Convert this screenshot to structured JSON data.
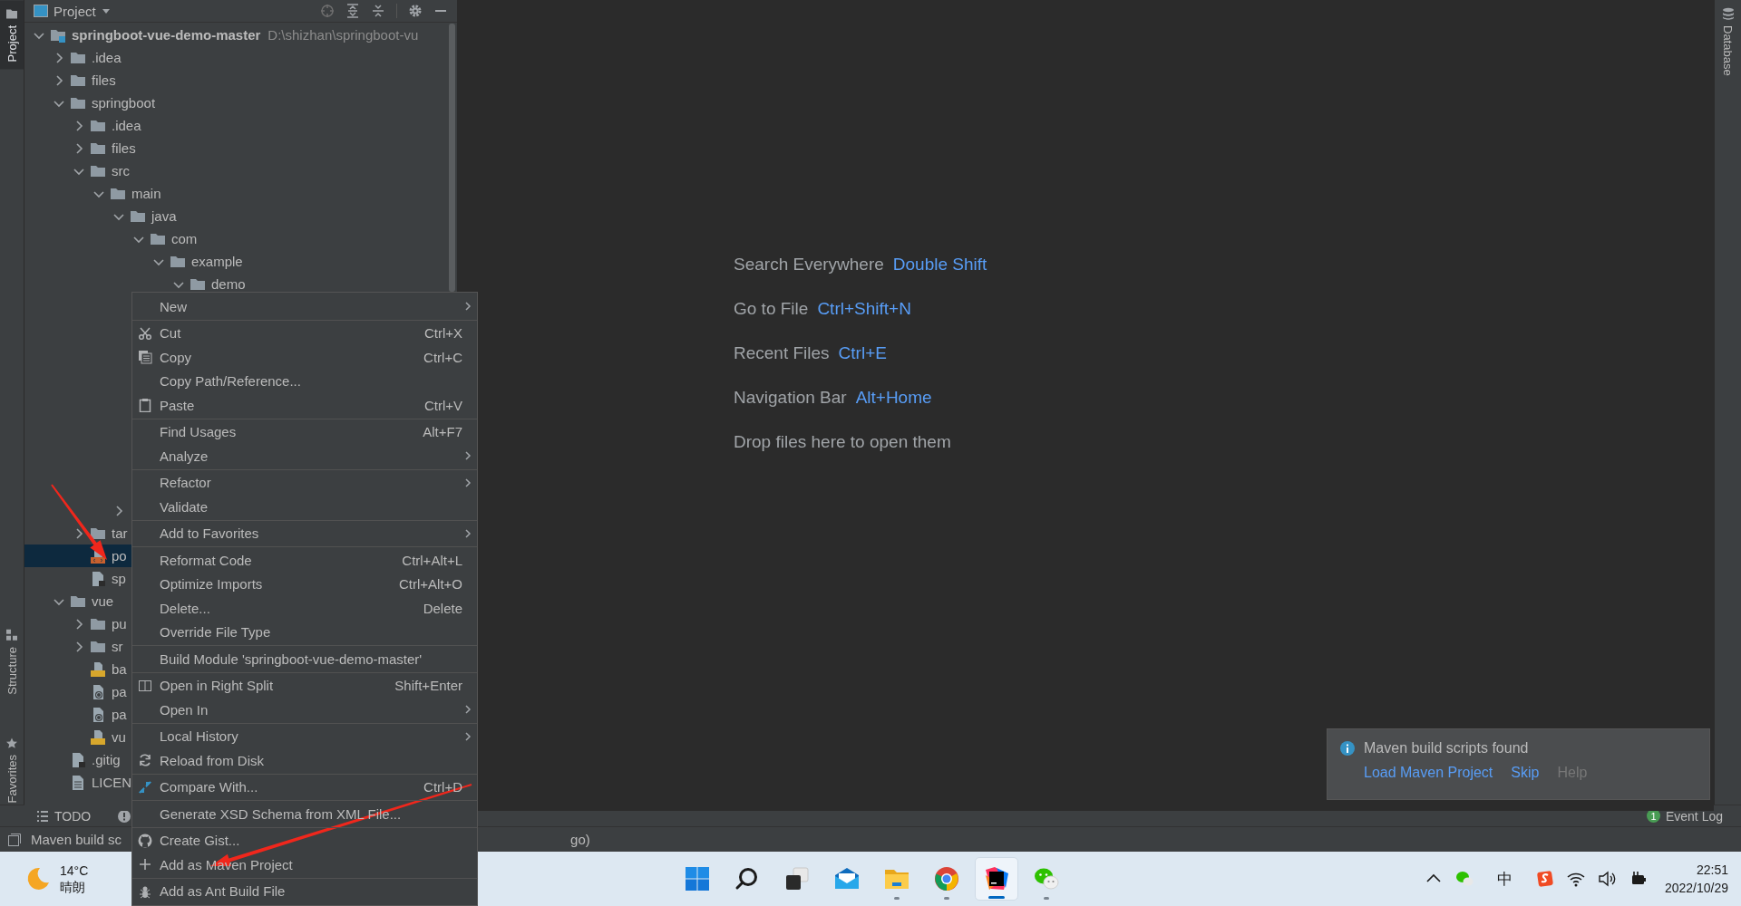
{
  "left_strip": {
    "tabs": [
      {
        "label": "Project",
        "selected": true
      },
      {
        "label": "Structure",
        "selected": false
      },
      {
        "label": "Favorites",
        "selected": false
      }
    ]
  },
  "project_panel": {
    "title": "Project",
    "tree": [
      {
        "label": "springboot-vue-demo-master",
        "path": "D:\\shizhan\\springboot-vu",
        "kind": "module",
        "expanded": true,
        "selected": false,
        "children": [
          {
            "label": ".idea",
            "kind": "folder",
            "expanded": false,
            "selected": false
          },
          {
            "label": "files",
            "kind": "folder",
            "expanded": false,
            "selected": false
          },
          {
            "label": "springboot",
            "kind": "folder",
            "expanded": true,
            "selected": false,
            "children": [
              {
                "label": ".idea",
                "kind": "folder",
                "expanded": false,
                "selected": false
              },
              {
                "label": "files",
                "kind": "folder",
                "expanded": false,
                "selected": false
              },
              {
                "label": "src",
                "kind": "folder",
                "expanded": true,
                "selected": false,
                "children": [
                  {
                    "label": "main",
                    "kind": "folder",
                    "expanded": true,
                    "selected": false,
                    "children": [
                      {
                        "label": "java",
                        "kind": "folder",
                        "expanded": true,
                        "selected": false,
                        "children": [
                          {
                            "label": "com",
                            "kind": "folder",
                            "expanded": true,
                            "selected": false,
                            "children": [
                              {
                                "label": "example",
                                "kind": "folder",
                                "expanded": true,
                                "selected": false,
                                "children": [
                                  {
                                    "label": "demo",
                                    "kind": "folder",
                                    "expanded": true,
                                    "selected": false
                                  }
                                ]
                              }
                            ]
                          }
                        ]
                      },
                      {
                        "kind": "folder",
                        "expanded": false,
                        "selected": false
                      }
                    ]
                  }
                ]
              },
              {
                "label": "tar",
                "kind": "folder",
                "expanded": false,
                "selected": false
              },
              {
                "label": "po",
                "kind": "xml",
                "selected": true
              },
              {
                "label": "sp",
                "kind": "file",
                "selected": false
              }
            ]
          },
          {
            "label": "vue",
            "kind": "folder",
            "expanded": true,
            "selected": false,
            "children": [
              {
                "label": "pu",
                "kind": "folder",
                "expanded": false,
                "selected": false
              },
              {
                "label": "sr",
                "kind": "folder",
                "expanded": false,
                "selected": false
              },
              {
                "label": "ba",
                "kind": "js",
                "selected": false
              },
              {
                "label": "pa",
                "kind": "json",
                "selected": false
              },
              {
                "label": "pa",
                "kind": "json",
                "selected": false
              },
              {
                "label": "vu",
                "kind": "js",
                "selected": false
              }
            ]
          },
          {
            "label": ".gitig",
            "kind": "file",
            "selected": false
          },
          {
            "label": "LICEN",
            "kind": "text",
            "selected": false
          }
        ]
      }
    ]
  },
  "editor": {
    "hints": [
      {
        "label": "Search Everywhere",
        "shortcut": "Double Shift"
      },
      {
        "label": "Go to File",
        "shortcut": "Ctrl+Shift+N"
      },
      {
        "label": "Recent Files",
        "shortcut": "Ctrl+E"
      },
      {
        "label": "Navigation Bar",
        "shortcut": "Alt+Home"
      },
      {
        "label": "Drop files here to open them"
      }
    ],
    "notification": {
      "message": "Maven build scripts found",
      "links": [
        {
          "label": "Load Maven Project",
          "disabled": false
        },
        {
          "label": "Skip",
          "disabled": false
        },
        {
          "label": "Help",
          "disabled": true
        }
      ]
    }
  },
  "right_strip": {
    "tabs": [
      {
        "label": "Database",
        "selected": false
      }
    ]
  },
  "context_menu": {
    "groups": [
      [
        {
          "label": "New",
          "submenu": true
        }
      ],
      [
        {
          "label": "Cut",
          "shortcut": "Ctrl+X",
          "submenu": false
        },
        {
          "label": "Copy",
          "shortcut": "Ctrl+C",
          "submenu": false
        },
        {
          "label": "Copy Path/Reference...",
          "submenu": false
        },
        {
          "label": "Paste",
          "shortcut": "Ctrl+V",
          "submenu": false
        }
      ],
      [
        {
          "label": "Find Usages",
          "shortcut": "Alt+F7",
          "submenu": false
        },
        {
          "label": "Analyze",
          "submenu": true
        }
      ],
      [
        {
          "label": "Refactor",
          "submenu": true
        },
        {
          "label": "Validate",
          "submenu": false
        }
      ],
      [
        {
          "label": "Add to Favorites",
          "submenu": true
        }
      ],
      [
        {
          "label": "Reformat Code",
          "shortcut": "Ctrl+Alt+L",
          "submenu": false
        },
        {
          "label": "Optimize Imports",
          "shortcut": "Ctrl+Alt+O",
          "submenu": false
        },
        {
          "label": "Delete...",
          "shortcut": "Delete",
          "submenu": false
        },
        {
          "label": "Override File Type",
          "submenu": false
        }
      ],
      [
        {
          "label": "Build Module 'springboot-vue-demo-master'",
          "submenu": false
        }
      ],
      [
        {
          "label": "Open in Right Split",
          "shortcut": "Shift+Enter",
          "submenu": false
        },
        {
          "label": "Open In",
          "submenu": true
        }
      ],
      [
        {
          "label": "Local History",
          "submenu": true
        },
        {
          "label": "Reload from Disk",
          "submenu": false
        }
      ],
      [
        {
          "label": "Compare With...",
          "shortcut": "Ctrl+D",
          "submenu": false
        }
      ],
      [
        {
          "label": "Generate XSD Schema from XML File...",
          "submenu": false
        }
      ],
      [
        {
          "label": "Create Gist...",
          "submenu": false
        },
        {
          "label": "Add as Maven Project",
          "submenu": false
        }
      ],
      [
        {
          "label": "Add as Ant Build File",
          "submenu": false
        }
      ]
    ]
  },
  "tool_window_bar": {
    "left": [
      {
        "label": "TODO"
      }
    ],
    "event_log": {
      "label": "Event Log",
      "count": "1"
    }
  },
  "status_bar": {
    "texts": [
      "Maven build sc",
      "go)"
    ]
  },
  "taskbar": {
    "weather": {
      "temperature": "14°C",
      "condition": "晴朗"
    },
    "apps": [
      {
        "running": false,
        "selected": false
      },
      {
        "running": false,
        "selected": false
      },
      {
        "running": false,
        "selected": false
      },
      {
        "running": false,
        "selected": false
      },
      {
        "running": true,
        "selected": false
      },
      {
        "running": true,
        "selected": false
      },
      {
        "running": true,
        "selected": true
      },
      {
        "running": true,
        "selected": false
      }
    ],
    "input_method": "中",
    "time": "22:51",
    "date": "2022/10/29"
  }
}
